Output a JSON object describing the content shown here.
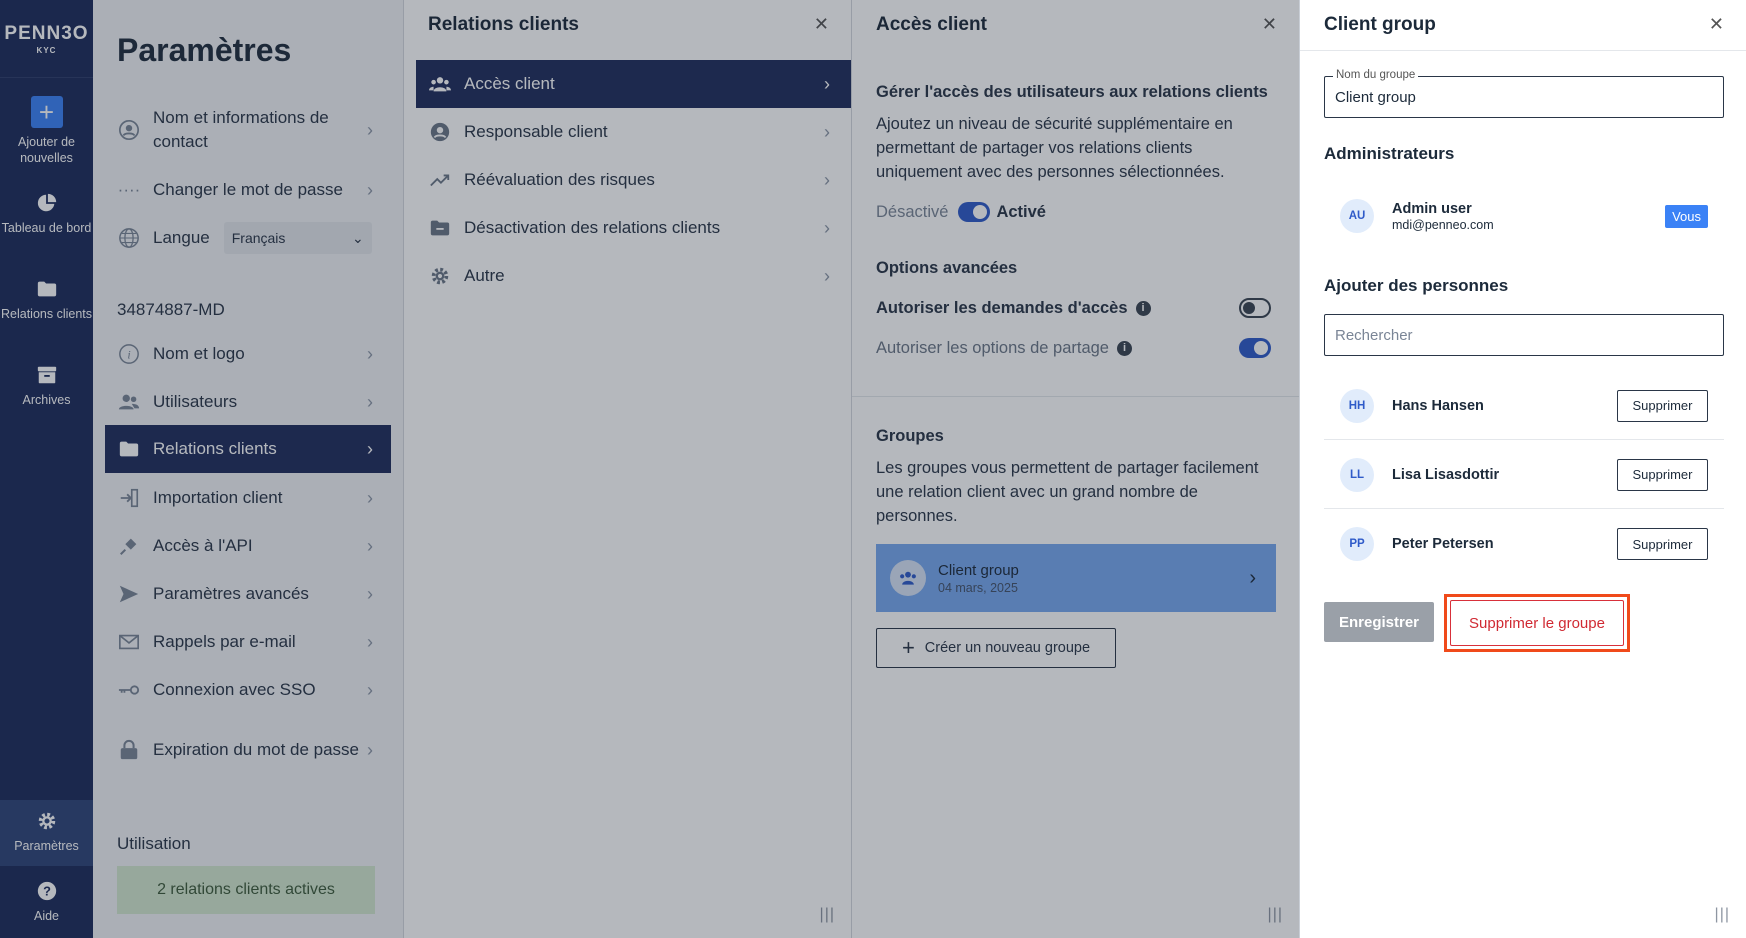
{
  "nav": {
    "logo_main": "PENN3O",
    "logo_sub": "KYC",
    "items": [
      {
        "label": "Ajouter de nouvelles",
        "icon": "plus-icon"
      },
      {
        "label": "Tableau de bord",
        "icon": "pie-chart-icon"
      },
      {
        "label": "Relations clients",
        "icon": "folder-icon"
      },
      {
        "label": "Archives",
        "icon": "archive-icon"
      },
      {
        "label": "Paramètres",
        "icon": "gear-icon"
      },
      {
        "label": "Aide",
        "icon": "help-icon"
      }
    ]
  },
  "settings": {
    "title": "Paramètres",
    "personal": [
      {
        "label": "Nom et informations de contact",
        "icon": "user-icon"
      },
      {
        "label": "Changer le mot de passe",
        "icon": "password-icon"
      }
    ],
    "language_label": "Langue",
    "language_value": "Français",
    "company_id": "34874887-MD",
    "company": [
      {
        "label": "Nom et logo",
        "icon": "info-icon"
      },
      {
        "label": "Utilisateurs",
        "icon": "users-icon"
      },
      {
        "label": "Relations clients",
        "icon": "folder-icon"
      },
      {
        "label": "Importation client",
        "icon": "import-icon"
      },
      {
        "label": "Accès à l'API",
        "icon": "plug-icon"
      },
      {
        "label": "Paramètres avancés",
        "icon": "send-icon"
      },
      {
        "label": "Rappels par e-mail",
        "icon": "mail-icon"
      },
      {
        "label": "Connexion avec SSO",
        "icon": "key-icon"
      },
      {
        "label": "Expiration du mot de passe",
        "icon": "lock-icon"
      }
    ],
    "usage_title": "Utilisation",
    "usage_value": "2 relations clients actives"
  },
  "relations_panel": {
    "title": "Relations clients",
    "items": [
      {
        "label": "Accès client",
        "icon": "users-icon"
      },
      {
        "label": "Responsable client",
        "icon": "user-circle-icon"
      },
      {
        "label": "Réévaluation des risques",
        "icon": "trend-icon"
      },
      {
        "label": "Désactivation des relations clients",
        "icon": "folder-minus-icon"
      },
      {
        "label": "Autre",
        "icon": "gear-icon"
      }
    ]
  },
  "access_panel": {
    "title": "Accès client",
    "heading": "Gérer l'accès des utilisateurs aux relations clients",
    "description": "Ajoutez un niveau de sécurité supplémentaire en permettant de partager vos relations clients uniquement avec des personnes sélectionnées.",
    "toggle_off_label": "Désactivé",
    "toggle_on_label": "Activé",
    "advanced_title": "Options avancées",
    "opt_requests": "Autoriser les demandes d'accès",
    "opt_sharing": "Autoriser les options de partage",
    "groups_title": "Groupes",
    "groups_description": "Les groupes vous permettent de partager facilement une relation client avec un grand nombre de personnes.",
    "group_name": "Client group",
    "group_date": "04 mars, 2025",
    "create_group": "Créer un nouveau groupe"
  },
  "group_panel": {
    "title": "Client group",
    "name_label": "Nom du groupe",
    "name_value": "Client group",
    "admins_title": "Administrateurs",
    "admin": {
      "initials": "AU",
      "name": "Admin user",
      "email": "mdi@penneo.com",
      "badge": "Vous"
    },
    "add_title": "Ajouter des personnes",
    "search_placeholder": "Rechercher",
    "members": [
      {
        "initials": "HH",
        "name": "Hans Hansen",
        "action": "Supprimer"
      },
      {
        "initials": "LL",
        "name": "Lisa Lisasdottir",
        "action": "Supprimer"
      },
      {
        "initials": "PP",
        "name": "Peter Petersen",
        "action": "Supprimer"
      }
    ],
    "save": "Enregistrer",
    "delete": "Supprimer le groupe"
  }
}
